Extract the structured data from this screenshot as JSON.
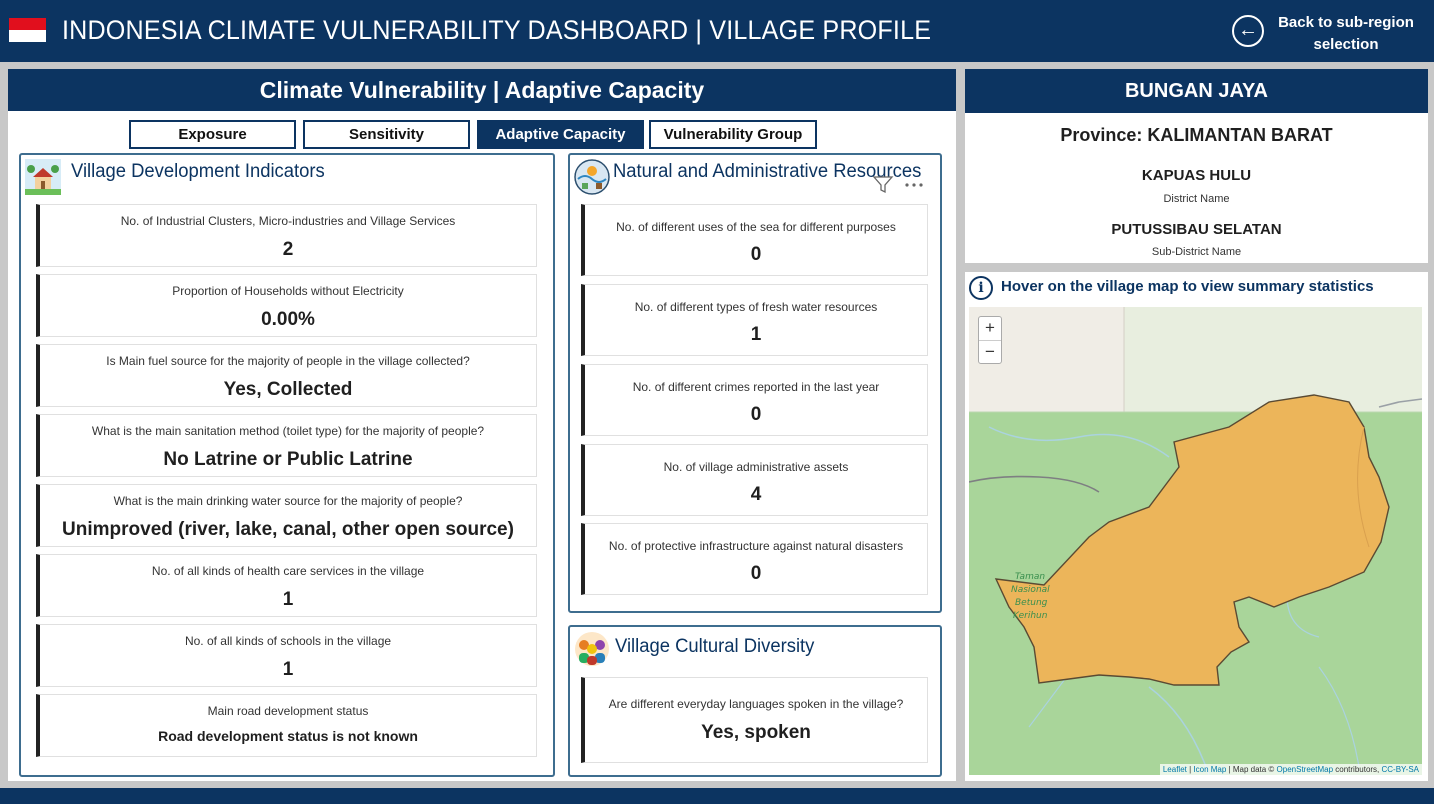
{
  "header": {
    "title": "INDONESIA CLIMATE VULNERABILITY DASHBOARD | VILLAGE PROFILE",
    "back_label": "Back to sub-region selection"
  },
  "left_panel": {
    "title": "Climate Vulnerability | Adaptive Capacity",
    "tabs": [
      {
        "label": "Exposure",
        "active": false
      },
      {
        "label": "Sensitivity",
        "active": false
      },
      {
        "label": "Adaptive Capacity",
        "active": true
      },
      {
        "label": "Vulnerability Group",
        "active": false
      }
    ],
    "village_development": {
      "title": "Village Development Indicators",
      "items": [
        {
          "question": "No. of Industrial Clusters, Micro-industries and Village Services",
          "value": "2"
        },
        {
          "question": "Proportion of Households without Electricity",
          "value": "0.00%"
        },
        {
          "question": "Is Main fuel source for the majority of people in the village collected?",
          "value": "Yes, Collected"
        },
        {
          "question": "What is the main sanitation method (toilet type) for the majority of people?",
          "value": "No Latrine or Public Latrine"
        },
        {
          "question": "What is the main drinking water source for the majority of people?",
          "value": "Unimproved (river, lake, canal, other open source)"
        },
        {
          "question": "No. of all kinds of health care services in the village",
          "value": "1"
        },
        {
          "question": "No. of all kinds of schools in the village",
          "value": "1"
        },
        {
          "question": "Main road development status",
          "value": "Road development status is not known"
        }
      ]
    },
    "natural_resources": {
      "title": "Natural and Administrative Resources",
      "items": [
        {
          "question": "No. of different uses of the sea for different purposes",
          "value": "0"
        },
        {
          "question": "No. of different types of fresh water resources",
          "value": "1"
        },
        {
          "question": "No. of different crimes reported in the last year",
          "value": "0"
        },
        {
          "question": "No. of village administrative assets",
          "value": "4"
        },
        {
          "question": "No. of protective infrastructure against natural disasters",
          "value": "0"
        }
      ]
    },
    "cultural_diversity": {
      "title": "Village Cultural Diversity",
      "items": [
        {
          "question": "Are different everyday languages spoken in the village?",
          "value": "Yes, spoken"
        }
      ]
    }
  },
  "village": {
    "name": "BUNGAN JAYA",
    "province": "Province: KALIMANTAN BARAT",
    "district": "KAPUAS HULU",
    "district_label": "District Name",
    "subdistrict": "PUTUSSIBAU SELATAN",
    "subdistrict_label": "Sub-District Name"
  },
  "map": {
    "hint": "Hover on the village map to view summary statistics",
    "zoom_in": "+",
    "zoom_out": "−",
    "park_label": [
      "Taman",
      "Nasional",
      "Betung",
      "Kerihun"
    ],
    "attribution": {
      "leaflet": "Leaflet",
      "sep1": " | ",
      "icon_map": "Icon Map",
      "sep2": " | Map data © ",
      "osm": "OpenStreetMap",
      "contrib": " contributors, ",
      "license": "CC-BY-SA"
    },
    "colors": {
      "village_fill": "#ecb55a",
      "park": "#a9d59a",
      "water": "#aad3df",
      "land": "#f0ede6"
    }
  },
  "colors": {
    "navy": "#0c3461",
    "card_border": "#3e6d8f",
    "flag_red": "#e10f1d"
  }
}
